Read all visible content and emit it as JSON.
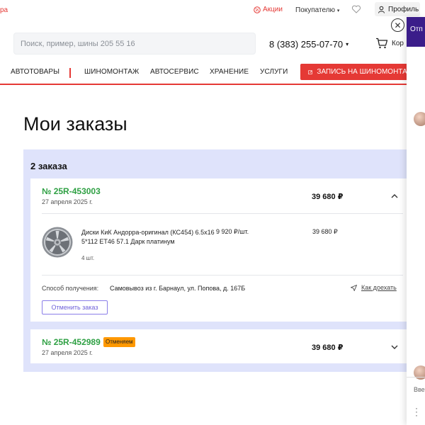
{
  "topbar": {
    "city_fragment": "ра",
    "promo_label": "Акции",
    "buyer_label": "Покупателю",
    "profile_label": "Профиль"
  },
  "header": {
    "search_placeholder": "Поиск, пример, шины 205 55 16",
    "phone": "8 (383) 255-07-70",
    "cart_label_fragment": "Кор"
  },
  "nav": {
    "items": [
      "АВТОТОВАРЫ",
      "ШИНОМОНТАЖ",
      "АВТОСЕРВИС",
      "ХРАНЕНИЕ",
      "УСЛУГИ"
    ],
    "cta_label": "ЗАПИСЬ НА ШИНОМОНТАЖ"
  },
  "page": {
    "title": "Мои заказы",
    "orders_count": "2 заказа"
  },
  "orders": [
    {
      "number": "№ 25R-453003",
      "date": "27 апреля 2025 г.",
      "total": "39 680 ₽",
      "item": {
        "name": "Диски КиК Андорра-оригинал (КС454) 6.5x16 5*112 ET46 57.1 Дарк платинум",
        "price": "9 920 ₽/шт.",
        "sum": "39 680 ₽",
        "qty": "4 шт."
      },
      "delivery_label": "Способ получения:",
      "delivery_value": "Самовывоз из г. Барнаул, ул. Попова, д. 167Б",
      "route_label": "Как доехать",
      "cancel_label": "Отменить заказ"
    },
    {
      "number": "№ 25R-452989",
      "badge": "Отменяем",
      "date": "27 апреля 2025 г.",
      "total": "39 680 ₽"
    }
  ],
  "side_panel": {
    "header_fragment": "Отп",
    "input_fragment": "Вве"
  },
  "colors": {
    "brand_red": "#e53935",
    "order_green": "#2ea043",
    "panel_lavender": "#dfe3fb",
    "badge_orange": "#ff9800",
    "button_purple": "#6f61d9",
    "side_header": "#3b1d8a"
  },
  "icons": [
    "percent-icon",
    "heart-icon",
    "user-icon",
    "cart-icon",
    "close-icon",
    "edit-icon",
    "chevron-up-icon",
    "chevron-down-icon",
    "navigation-arrow-icon",
    "wheel-image",
    "kebab-menu-icon"
  ]
}
